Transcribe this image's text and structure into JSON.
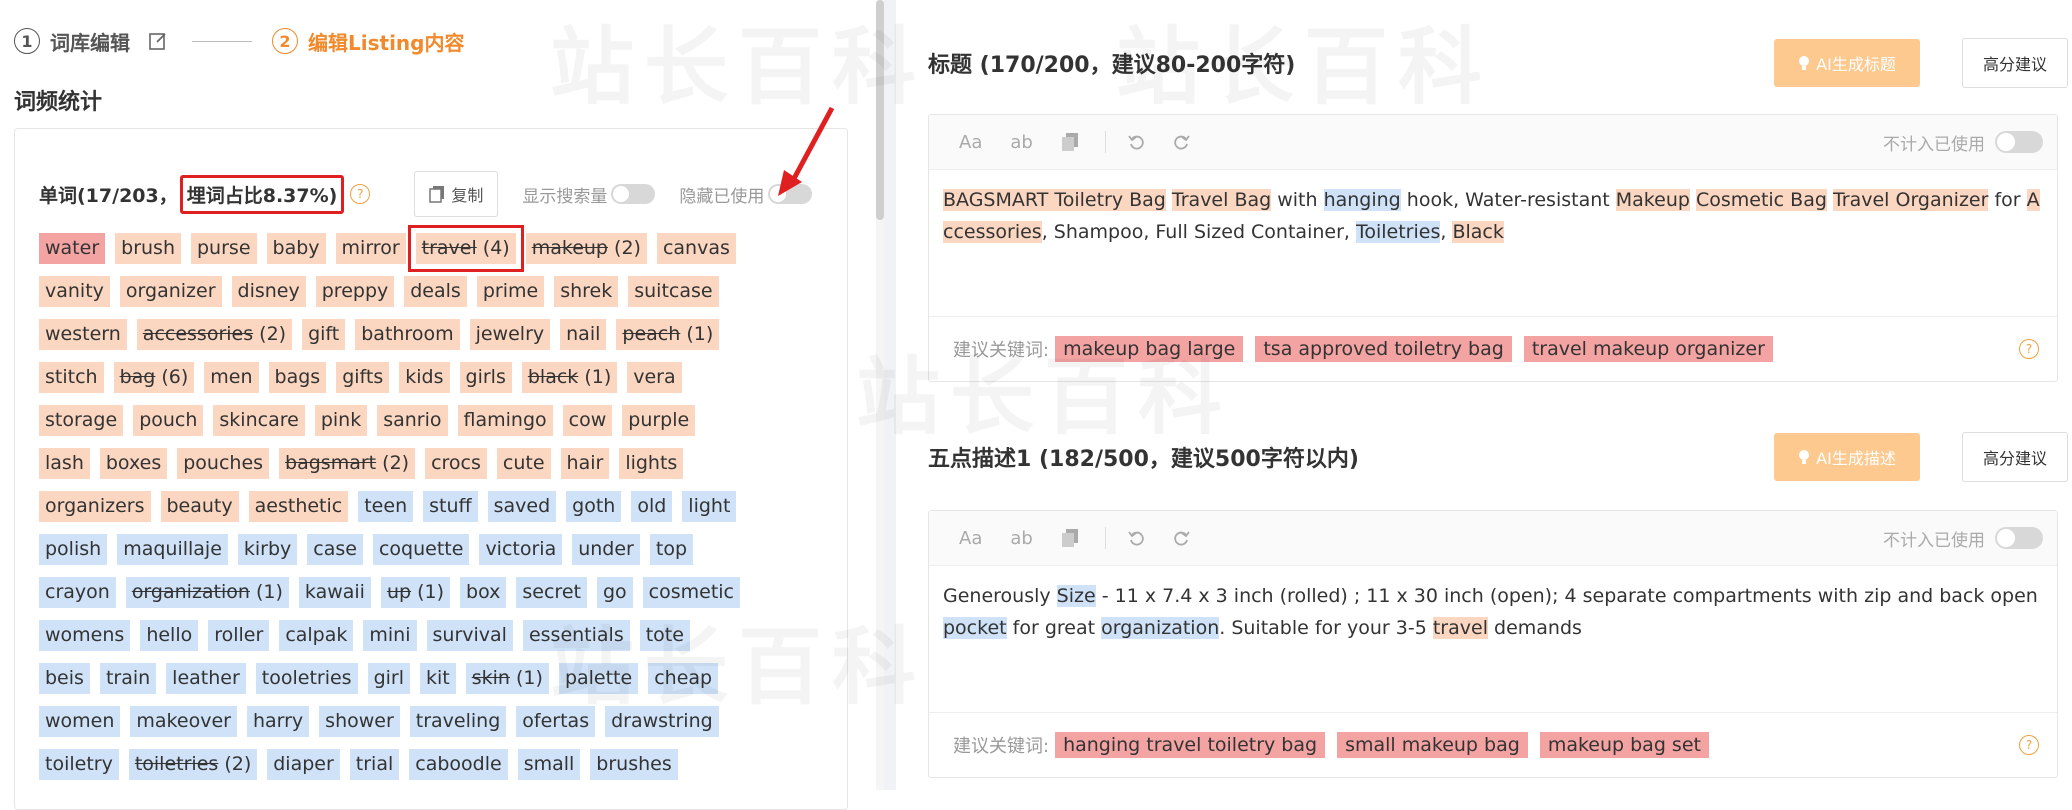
{
  "steps": [
    {
      "num": "1",
      "label": "词库编辑"
    },
    {
      "num": "2",
      "label": "编辑Listing内容"
    }
  ],
  "word_freq": {
    "title": "词频统计",
    "word_count": "单词(17/203，",
    "ratio": "埋词占比8.37%)",
    "copy_label": "复制",
    "show_search_label": "显示搜索量",
    "hide_used_label": "隐藏已使用",
    "rows": [
      [
        {
          "w": "water",
          "c": "red"
        },
        {
          "w": "brush",
          "c": "orange"
        },
        {
          "w": "purse",
          "c": "orange"
        },
        {
          "w": "baby",
          "c": "orange"
        },
        {
          "w": "mirror",
          "c": "orange"
        },
        {
          "w": "travel",
          "n": "(4)",
          "c": "orange",
          "used": true,
          "boxed": true
        },
        {
          "w": "makeup",
          "n": "(2)",
          "c": "orange",
          "used": true
        },
        {
          "w": "canvas",
          "c": "orange"
        }
      ],
      [
        {
          "w": "vanity",
          "c": "orange"
        },
        {
          "w": "organizer",
          "c": "orange"
        },
        {
          "w": "disney",
          "c": "orange"
        },
        {
          "w": "preppy",
          "c": "orange"
        },
        {
          "w": "deals",
          "c": "orange"
        },
        {
          "w": "prime",
          "c": "orange"
        },
        {
          "w": "shrek",
          "c": "orange"
        },
        {
          "w": "suitcase",
          "c": "orange"
        }
      ],
      [
        {
          "w": "western",
          "c": "orange"
        },
        {
          "w": "accessories",
          "n": "(2)",
          "c": "orange",
          "used": true
        },
        {
          "w": "gift",
          "c": "orange"
        },
        {
          "w": "bathroom",
          "c": "orange"
        },
        {
          "w": "jewelry",
          "c": "orange"
        },
        {
          "w": "nail",
          "c": "orange"
        },
        {
          "w": "peach",
          "n": "(1)",
          "c": "orange",
          "used": true
        }
      ],
      [
        {
          "w": "stitch",
          "c": "orange"
        },
        {
          "w": "bag",
          "n": "(6)",
          "c": "orange",
          "used": true
        },
        {
          "w": "men",
          "c": "orange"
        },
        {
          "w": "bags",
          "c": "orange"
        },
        {
          "w": "gifts",
          "c": "orange"
        },
        {
          "w": "kids",
          "c": "orange"
        },
        {
          "w": "girls",
          "c": "orange"
        },
        {
          "w": "black",
          "n": "(1)",
          "c": "orange",
          "used": true
        },
        {
          "w": "vera",
          "c": "orange"
        }
      ],
      [
        {
          "w": "storage",
          "c": "orange"
        },
        {
          "w": "pouch",
          "c": "orange"
        },
        {
          "w": "skincare",
          "c": "orange"
        },
        {
          "w": "pink",
          "c": "orange"
        },
        {
          "w": "sanrio",
          "c": "orange"
        },
        {
          "w": "flamingo",
          "c": "orange"
        },
        {
          "w": "cow",
          "c": "orange"
        },
        {
          "w": "purple",
          "c": "orange"
        }
      ],
      [
        {
          "w": "lash",
          "c": "orange"
        },
        {
          "w": "boxes",
          "c": "orange"
        },
        {
          "w": "pouches",
          "c": "orange"
        },
        {
          "w": "bagsmart",
          "n": "(2)",
          "c": "orange",
          "used": true
        },
        {
          "w": "crocs",
          "c": "orange"
        },
        {
          "w": "cute",
          "c": "orange"
        },
        {
          "w": "hair",
          "c": "orange"
        },
        {
          "w": "lights",
          "c": "orange"
        }
      ],
      [
        {
          "w": "organizers",
          "c": "orange"
        },
        {
          "w": "beauty",
          "c": "orange"
        },
        {
          "w": "aesthetic",
          "c": "orange"
        },
        {
          "w": "teen",
          "c": "blue"
        },
        {
          "w": "stuff",
          "c": "blue"
        },
        {
          "w": "saved",
          "c": "blue"
        },
        {
          "w": "goth",
          "c": "blue"
        },
        {
          "w": "old",
          "c": "blue"
        },
        {
          "w": "light",
          "c": "blue"
        }
      ],
      [
        {
          "w": "polish",
          "c": "blue"
        },
        {
          "w": "maquillaje",
          "c": "blue"
        },
        {
          "w": "kirby",
          "c": "blue"
        },
        {
          "w": "case",
          "c": "blue"
        },
        {
          "w": "coquette",
          "c": "blue"
        },
        {
          "w": "victoria",
          "c": "blue"
        },
        {
          "w": "under",
          "c": "blue"
        },
        {
          "w": "top",
          "c": "blue"
        }
      ],
      [
        {
          "w": "crayon",
          "c": "blue"
        },
        {
          "w": "organization",
          "n": "(1)",
          "c": "blue",
          "used": true
        },
        {
          "w": "kawaii",
          "c": "blue"
        },
        {
          "w": "up",
          "n": "(1)",
          "c": "blue",
          "used": true
        },
        {
          "w": "box",
          "c": "blue"
        },
        {
          "w": "secret",
          "c": "blue"
        },
        {
          "w": "go",
          "c": "blue"
        },
        {
          "w": "cosmetic",
          "c": "blue"
        }
      ],
      [
        {
          "w": "womens",
          "c": "blue"
        },
        {
          "w": "hello",
          "c": "blue"
        },
        {
          "w": "roller",
          "c": "blue"
        },
        {
          "w": "calpak",
          "c": "blue"
        },
        {
          "w": "mini",
          "c": "blue"
        },
        {
          "w": "survival",
          "c": "blue"
        },
        {
          "w": "essentials",
          "c": "blue"
        },
        {
          "w": "tote",
          "c": "blue"
        }
      ],
      [
        {
          "w": "beis",
          "c": "blue"
        },
        {
          "w": "train",
          "c": "blue"
        },
        {
          "w": "leather",
          "c": "blue"
        },
        {
          "w": "tooletries",
          "c": "blue"
        },
        {
          "w": "girl",
          "c": "blue"
        },
        {
          "w": "kit",
          "c": "blue"
        },
        {
          "w": "skin",
          "n": "(1)",
          "c": "blue",
          "used": true
        },
        {
          "w": "palette",
          "c": "blue"
        },
        {
          "w": "cheap",
          "c": "blue"
        }
      ],
      [
        {
          "w": "women",
          "c": "blue"
        },
        {
          "w": "makeover",
          "c": "blue"
        },
        {
          "w": "harry",
          "c": "blue"
        },
        {
          "w": "shower",
          "c": "blue"
        },
        {
          "w": "traveling",
          "c": "blue"
        },
        {
          "w": "ofertas",
          "c": "blue"
        },
        {
          "w": "drawstring",
          "c": "blue"
        }
      ],
      [
        {
          "w": "toiletry",
          "c": "blue"
        },
        {
          "w": "toiletries",
          "n": "(2)",
          "c": "blue",
          "used": true
        },
        {
          "w": "diaper",
          "c": "blue"
        },
        {
          "w": "trial",
          "c": "blue"
        },
        {
          "w": "caboodle",
          "c": "blue"
        },
        {
          "w": "small",
          "c": "blue"
        },
        {
          "w": "brushes",
          "c": "blue"
        }
      ]
    ]
  },
  "title_section": {
    "heading": "标题 (170/200，建议80-200字符)",
    "ai_label": "AI生成标题",
    "adv_label": "高分建议",
    "not_count_label": "不计入已使用",
    "toolbar": {
      "aa": "Aa",
      "ab": "ab"
    },
    "content": [
      {
        "t": "BAGSMART Toiletry Bag",
        "c": "orange"
      },
      {
        "t": " "
      },
      {
        "t": "Travel Bag",
        "c": "orange"
      },
      {
        "t": " with "
      },
      {
        "t": "hanging",
        "c": "blue"
      },
      {
        "t": " hook, Water-resistant "
      },
      {
        "t": "Makeup",
        "c": "orange"
      },
      {
        "t": " "
      },
      {
        "t": "Cosmetic Bag",
        "c": "orange"
      },
      {
        "t": " "
      },
      {
        "t": "Travel Organizer",
        "c": "orange"
      },
      {
        "t": " for "
      },
      {
        "t": "Accessories",
        "c": "orange"
      },
      {
        "t": ", Shampoo, Full Sized Container, "
      },
      {
        "t": "Toiletries",
        "c": "blue"
      },
      {
        "t": ", "
      },
      {
        "t": "Black",
        "c": "orange"
      }
    ],
    "suggest_label": "建议关键词:",
    "suggest": [
      "makeup bag large",
      "tsa approved toiletry bag",
      "travel makeup organizer"
    ]
  },
  "bullet_section": {
    "heading": "五点描述1 (182/500，建议500字符以内)",
    "ai_label": "AI生成描述",
    "adv_label": "高分建议",
    "not_count_label": "不计入已使用",
    "toolbar": {
      "aa": "Aa",
      "ab": "ab"
    },
    "content": [
      {
        "t": "Generously "
      },
      {
        "t": "Size",
        "c": "blue"
      },
      {
        "t": " - 11 x 7.4 x 3 inch (rolled) ; 11 x 30 inch (open); 4 separate compartments with zip and back open "
      },
      {
        "t": "pocket",
        "c": "blue"
      },
      {
        "t": " for great "
      },
      {
        "t": "organization",
        "c": "blue"
      },
      {
        "t": ". Suitable for your 3-5 "
      },
      {
        "t": "travel",
        "c": "orange"
      },
      {
        "t": " demands"
      }
    ],
    "suggest_label": "建议关键词:",
    "suggest": [
      "hanging travel toiletry bag",
      "small makeup bag",
      "makeup bag set"
    ]
  },
  "watermark": "站长百科",
  "colors": {
    "accent": "#f08a2c",
    "highlight_red": "#f4a3a3",
    "highlight_orange": "#fbd7c1",
    "highlight_blue": "#cfe2f8",
    "box_red": "#e02020"
  }
}
